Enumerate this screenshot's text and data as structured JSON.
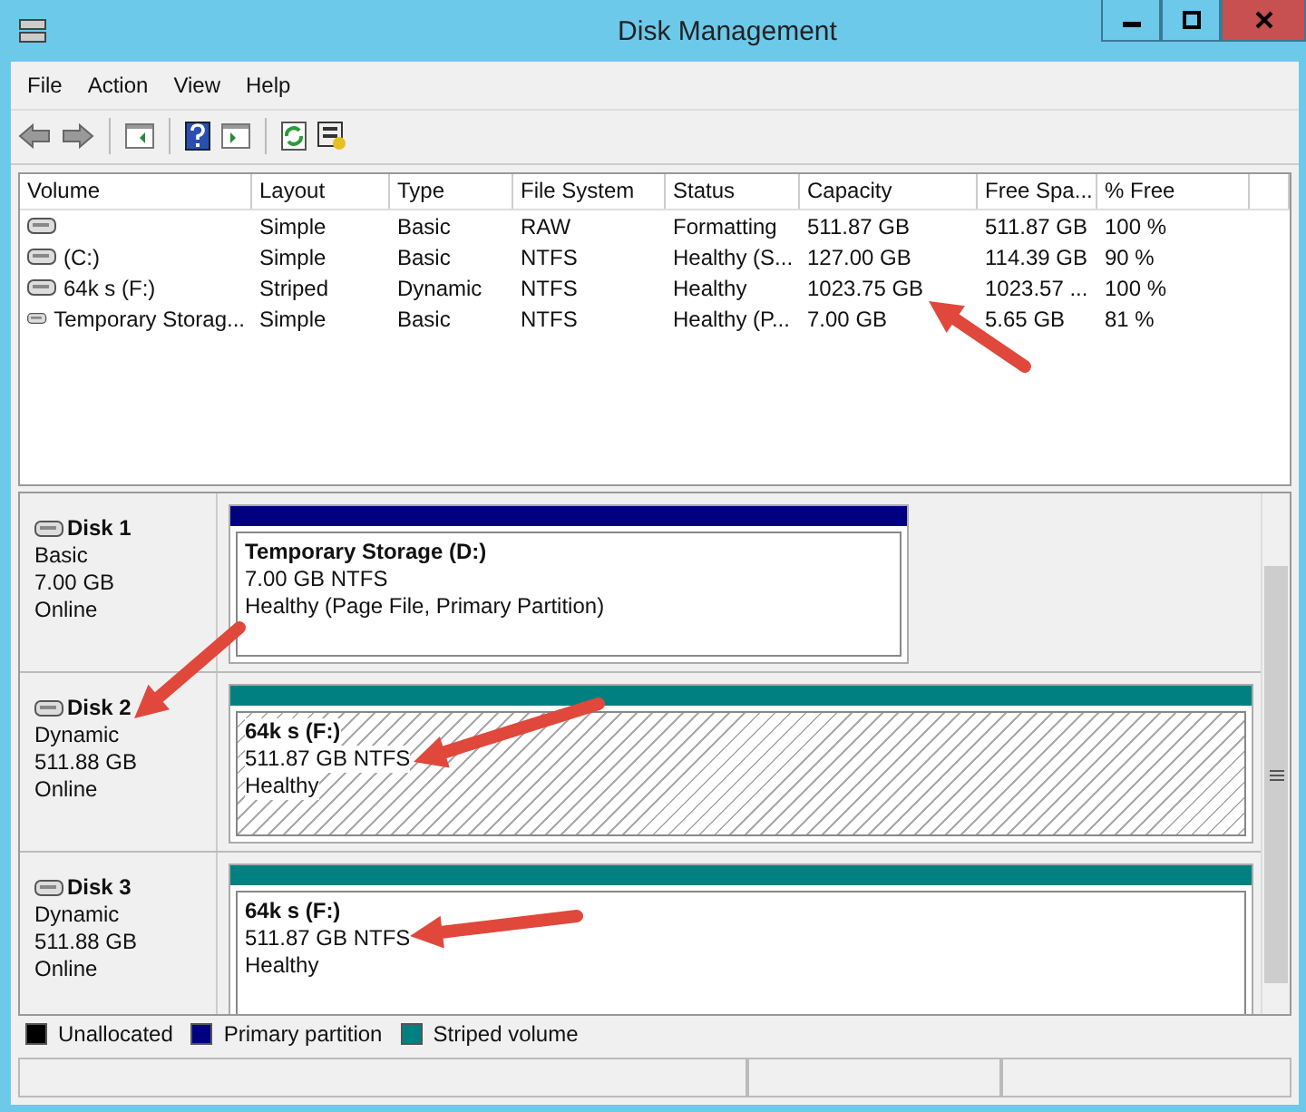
{
  "window": {
    "title": "Disk Management"
  },
  "menu": [
    "File",
    "Action",
    "View",
    "Help"
  ],
  "volume_table": {
    "columns": [
      "Volume",
      "Layout",
      "Type",
      "File System",
      "Status",
      "Capacity",
      "Free Spa...",
      "% Free"
    ],
    "rows": [
      {
        "cells": [
          "",
          "Simple",
          "Basic",
          "RAW",
          "Formatting",
          "511.87 GB",
          "511.87 GB",
          "100 %"
        ]
      },
      {
        "cells": [
          "(C:)",
          "Simple",
          "Basic",
          "NTFS",
          "Healthy (S...",
          "127.00 GB",
          "114.39 GB",
          "90 %"
        ]
      },
      {
        "cells": [
          "64k s (F:)",
          "Striped",
          "Dynamic",
          "NTFS",
          "Healthy",
          "1023.75 GB",
          "1023.57 ...",
          "100 %"
        ]
      },
      {
        "cells": [
          "Temporary Storag...",
          "Simple",
          "Basic",
          "NTFS",
          "Healthy (P...",
          "7.00 GB",
          "5.65 GB",
          "81 %"
        ]
      }
    ]
  },
  "disks": [
    {
      "name": "Disk 1",
      "type": "Basic",
      "size": "7.00 GB",
      "status": "Online",
      "partitions": [
        {
          "kind": "primary",
          "selected": false,
          "title": "Temporary Storage  (D:)",
          "size": "7.00 GB NTFS",
          "status": "Healthy (Page File, Primary Partition)"
        }
      ]
    },
    {
      "name": "Disk 2",
      "type": "Dynamic",
      "size": "511.88 GB",
      "status": "Online",
      "partitions": [
        {
          "kind": "striped",
          "selected": true,
          "title": "64k s  (F:)",
          "size": "511.87 GB NTFS",
          "status": "Healthy"
        }
      ]
    },
    {
      "name": "Disk 3",
      "type": "Dynamic",
      "size": "511.88 GB",
      "status": "Online",
      "partitions": [
        {
          "kind": "striped",
          "selected": false,
          "title": "64k s  (F:)",
          "size": "511.87 GB NTFS",
          "status": "Healthy"
        }
      ]
    }
  ],
  "legend": [
    {
      "label": "Unallocated",
      "color": "#000000"
    },
    {
      "label": "Primary partition",
      "color": "#000080"
    },
    {
      "label": "Striped volume",
      "color": "#008080"
    }
  ]
}
